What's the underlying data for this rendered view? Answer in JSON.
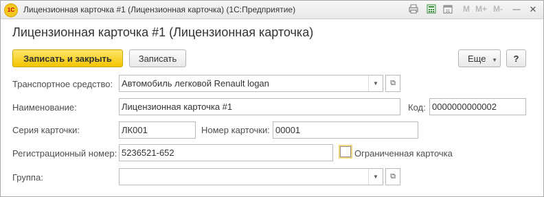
{
  "window": {
    "title": "Лицензионная карточка #1 (Лицензионная карточка)  (1С:Предприятие)",
    "logo_text": "1С",
    "toolbar_icons": [
      "print-icon",
      "calculator-icon",
      "calendar-icon"
    ],
    "memory_buttons": [
      "M",
      "M+",
      "M-"
    ],
    "minimize": "—",
    "close": "✕"
  },
  "form": {
    "heading": "Лицензионная карточка #1 (Лицензионная карточка)"
  },
  "commands": {
    "save_close": "Записать и закрыть",
    "save": "Записать",
    "more": "Еще",
    "help": "?"
  },
  "fields": {
    "vehicle": {
      "label": "Транспортное средство:",
      "value": "Автомобиль легковой Renault logan"
    },
    "name": {
      "label": "Наименование:",
      "value": "Лицензионная карточка #1"
    },
    "code": {
      "label": "Код:",
      "value": "0000000000002"
    },
    "series": {
      "label": "Серия карточки:",
      "value": "ЛК001"
    },
    "number": {
      "label": "Номер карточки:",
      "value": "00001"
    },
    "reg_number": {
      "label": "Регистрационный номер:",
      "value": "5236521-652"
    },
    "limited": {
      "label": "Ограниченная карточка",
      "checked": false
    },
    "group": {
      "label": "Группа:",
      "value": ""
    }
  },
  "colors": {
    "accent": "#f2c500",
    "checkbox_focus": "#f1d780"
  }
}
